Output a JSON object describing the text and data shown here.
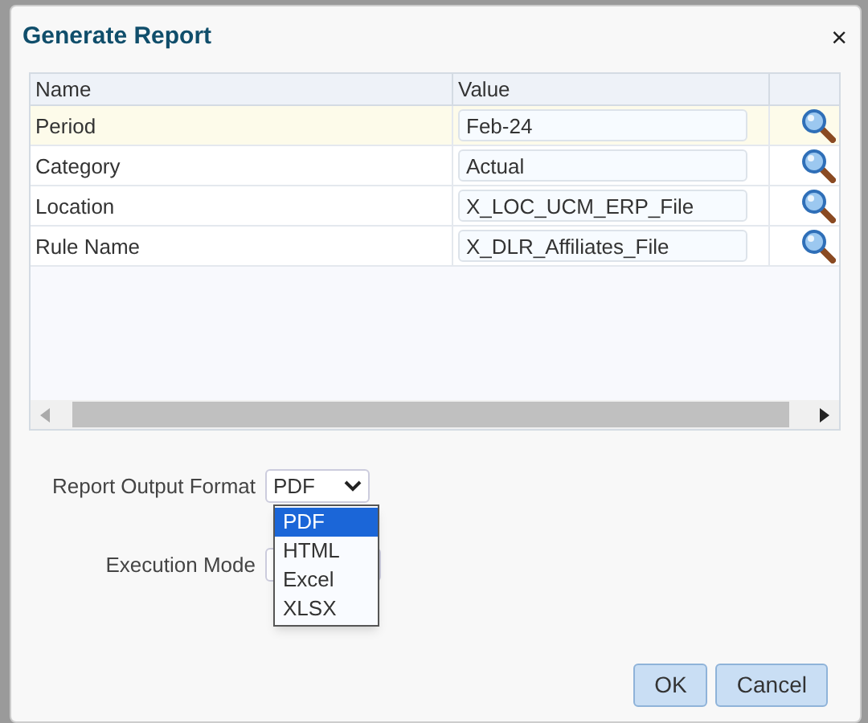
{
  "dialog": {
    "title": "Generate Report",
    "close": "×"
  },
  "table": {
    "columns": [
      "Name",
      "Value"
    ],
    "rows": [
      {
        "name": "Period",
        "value": "Feb-24",
        "selected": true
      },
      {
        "name": "Category",
        "value": "Actual",
        "selected": false
      },
      {
        "name": "Location",
        "value": "X_LOC_UCM_ERP_File",
        "selected": false
      },
      {
        "name": "Rule Name",
        "value": "X_DLR_Affiliates_File",
        "selected": false
      }
    ]
  },
  "output_format": {
    "label": "Report Output Format",
    "value": "PDF",
    "expanded": true,
    "options": [
      {
        "label": "PDF",
        "selected": true
      },
      {
        "label": "HTML",
        "selected": false
      },
      {
        "label": "Excel",
        "selected": false
      },
      {
        "label": "XLSX",
        "selected": false
      }
    ]
  },
  "execution_mode": {
    "label": "Execution Mode"
  },
  "buttons": [
    "OK",
    "Cancel"
  ]
}
